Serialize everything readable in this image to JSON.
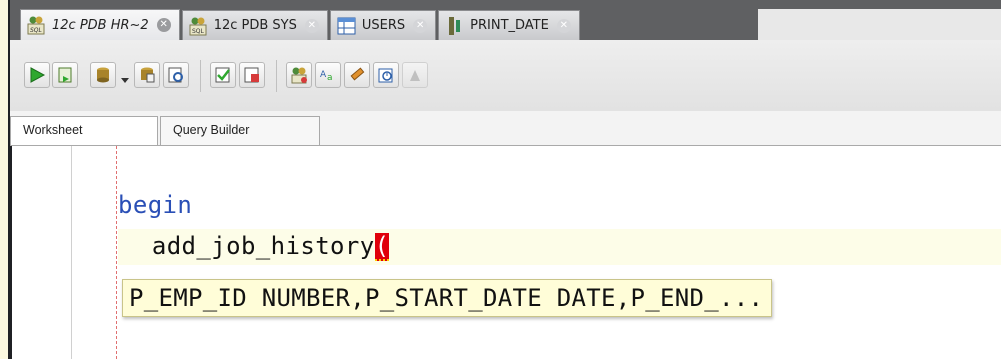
{
  "document_tabs": [
    {
      "label": "12c PDB HR~2",
      "icon": "sql-worksheet-icon",
      "active": true
    },
    {
      "label": "12c PDB SYS",
      "icon": "sql-worksheet-icon",
      "active": false
    },
    {
      "label": "USERS",
      "icon": "table-icon",
      "active": false
    },
    {
      "label": "PRINT_DATE",
      "icon": "procedure-icon",
      "active": false
    }
  ],
  "close_glyph": "✕",
  "toolbar": {
    "buttons": [
      "run-statement-icon",
      "run-script-icon",
      "commit-icon",
      "dropdown-arrow-icon",
      "rollback-icon",
      "explain-plan-icon",
      "autotrace-icon",
      "sql-tuning-icon",
      "unshared-sql-icon",
      "to-upper-lower-icon",
      "clear-icon",
      "history-icon",
      "format-icon"
    ]
  },
  "subtabs": {
    "worksheet": "Worksheet",
    "query_builder": "Query Builder"
  },
  "editor": {
    "line1": "begin",
    "line2_text": " add_job_history",
    "line2_paren": "(",
    "hint": "P_EMP_ID NUMBER,P_START_DATE DATE,P_END_..."
  },
  "colors": {
    "keyword": "#2a4fb6",
    "bracket_highlight": "#e0000a",
    "hint_bg": "#fffdd8"
  }
}
